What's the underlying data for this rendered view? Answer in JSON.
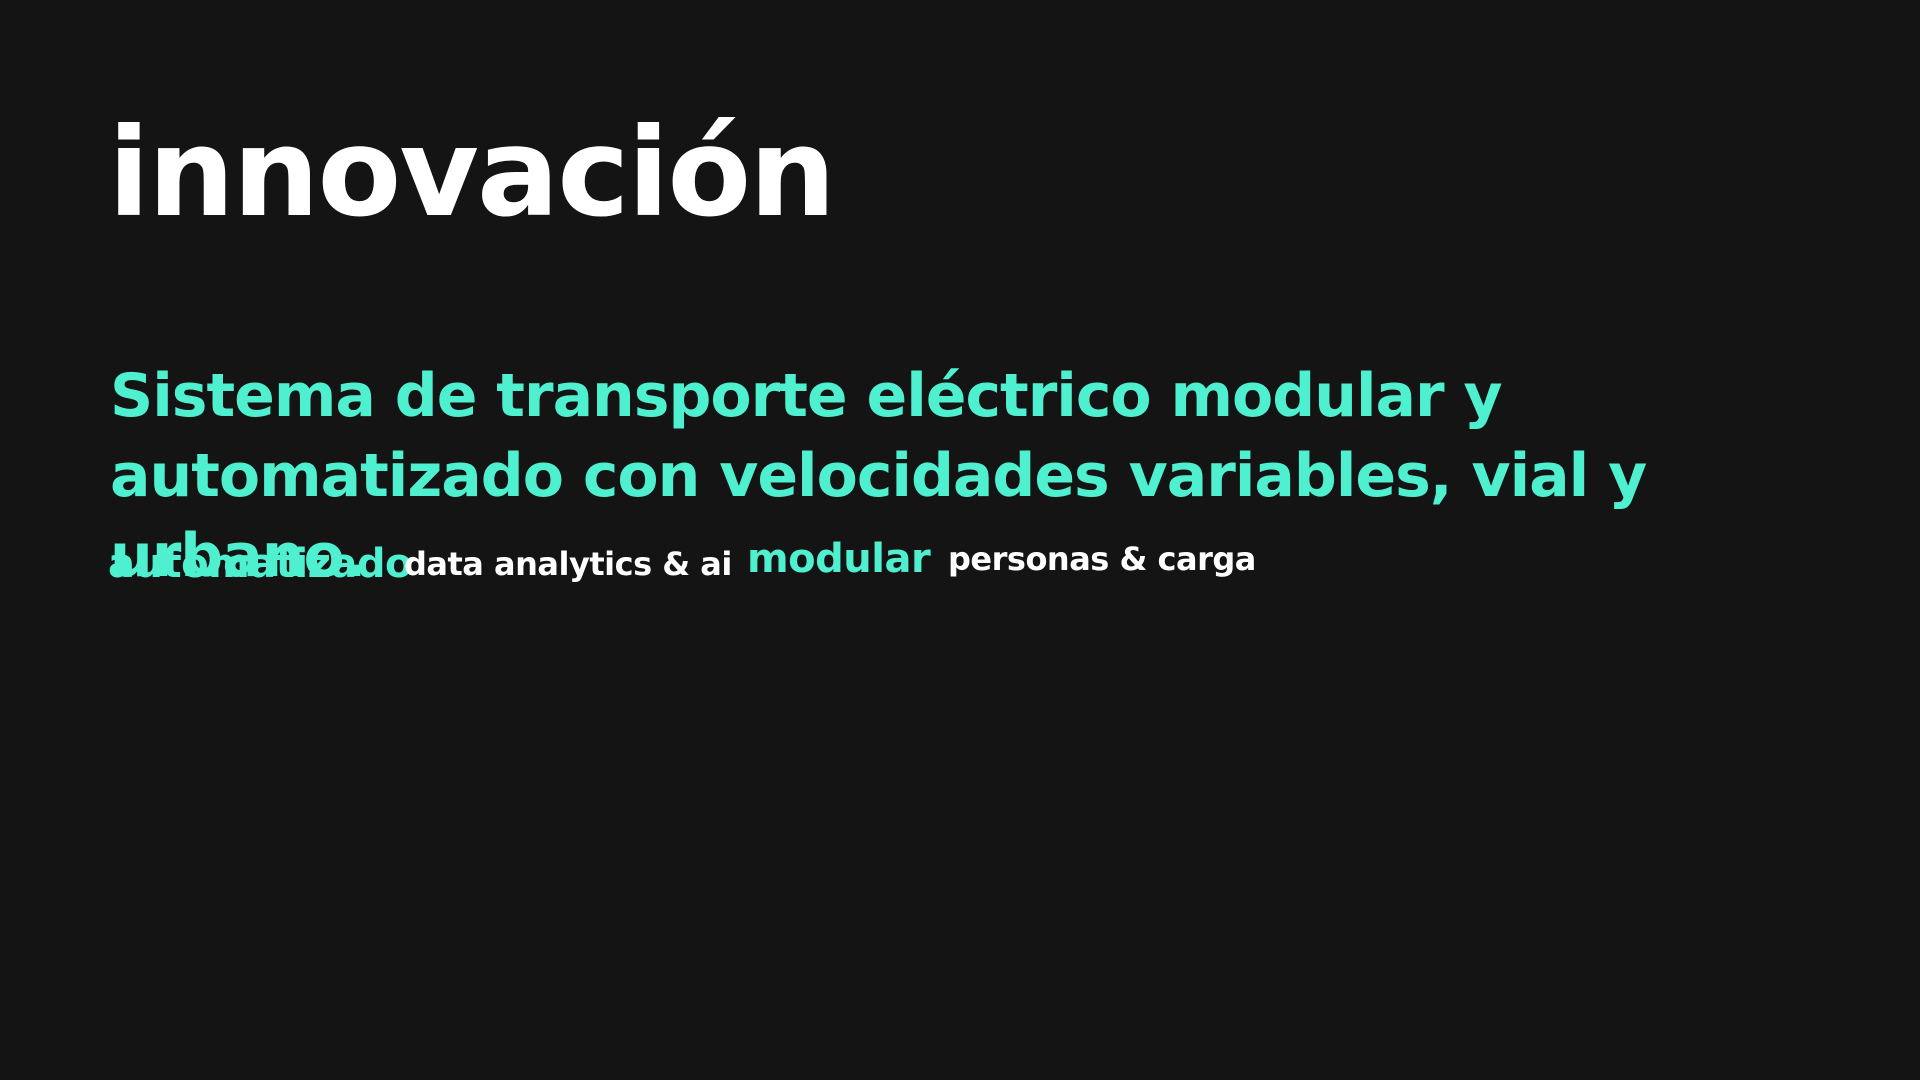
{
  "slide": {
    "title": "innovación",
    "subtitle": "Sistema de transporte eléctrico modular y automatizado con velocidades variables, vial y urbano.",
    "tags": [
      "automatizado",
      "data analytics & ai",
      "modular",
      "personas & carga"
    ]
  },
  "colors": {
    "background": "#141414",
    "accent": "#4ff0d0",
    "text": "#ffffff"
  }
}
